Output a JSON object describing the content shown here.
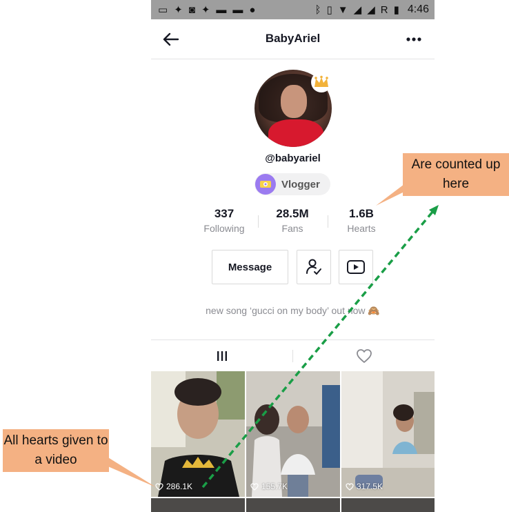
{
  "status_bar": {
    "time": "4:46",
    "left_icons": [
      "message-icon",
      "notification-icon",
      "app-icon",
      "notification-icon",
      "clapper-icon",
      "clapper-icon",
      "line-app-icon"
    ],
    "right_icons": [
      "bluetooth-icon",
      "vibrate-icon",
      "wifi-icon",
      "signal-icon",
      "no-signal-icon",
      "roaming-icon",
      "battery-icon"
    ],
    "roaming_label": "R"
  },
  "nav": {
    "title": "BabyAriel"
  },
  "profile": {
    "username": "@babyariel",
    "category_label": "Vlogger",
    "stats": [
      {
        "value": "337",
        "label": "Following"
      },
      {
        "value": "28.5M",
        "label": "Fans"
      },
      {
        "value": "1.6B",
        "label": "Hearts"
      }
    ],
    "message_button_label": "Message",
    "bio": "new song ‘gucci on my body’ out now 🙈"
  },
  "videos": [
    {
      "likes": "286.1K"
    },
    {
      "likes": "155.7K"
    },
    {
      "likes": "317.5K"
    }
  ],
  "annotations": {
    "top": "Are counted up here",
    "bottom": "All hearts given to a video"
  },
  "colors": {
    "status_bar": "#9e9e9e",
    "annotation_fill": "#f4b183",
    "arrow_green": "#1a9e47",
    "vlogger_purple": "#9b7bf0",
    "crown_gold": "#f2b23a",
    "text_primary": "#161823",
    "text_secondary": "#8a8b91"
  }
}
